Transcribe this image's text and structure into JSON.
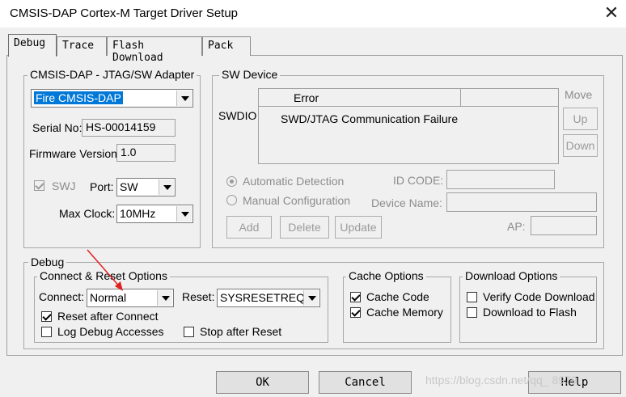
{
  "window": {
    "title": "CMSIS-DAP Cortex-M Target Driver Setup",
    "close_glyph": "✕"
  },
  "tabs": [
    {
      "label": "Debug",
      "active": true
    },
    {
      "label": "Trace",
      "active": false
    },
    {
      "label": "Flash Download",
      "active": false
    },
    {
      "label": "Pack",
      "active": false
    }
  ],
  "adapter": {
    "group_label": "CMSIS-DAP - JTAG/SW Adapter",
    "selected_adapter": "Fire CMSIS-DAP",
    "serial_label": "Serial No:",
    "serial_value": "HS-00014159",
    "firmware_label": "Firmware Version:",
    "firmware_value": "1.0",
    "swj_label": "SWJ",
    "swj_checked": true,
    "port_label": "Port:",
    "port_value": "SW",
    "max_clock_label": "Max Clock:",
    "max_clock_value": "10MHz"
  },
  "sw_device": {
    "group_label": "SW Device",
    "swdio_label": "SWDIO",
    "column_header": "Error",
    "error_text": "SWD/JTAG Communication Failure",
    "move_label": "Move",
    "up_label": "Up",
    "down_label": "Down",
    "auto_detect_label": "Automatic Detection",
    "manual_config_label": "Manual Configuration",
    "id_code_label": "ID CODE:",
    "device_name_label": "Device Name:",
    "ap_label": "AP:",
    "add_label": "Add",
    "delete_label": "Delete",
    "update_label": "Update"
  },
  "debug": {
    "group_label": "Debug",
    "connect_reset": {
      "group_label": "Connect & Reset Options",
      "connect_label": "Connect:",
      "connect_value": "Normal",
      "reset_label": "Reset:",
      "reset_value": "SYSRESETREQ",
      "reset_after_connect_label": "Reset after Connect",
      "reset_after_connect_checked": true,
      "log_debug_label": "Log Debug Accesses",
      "log_debug_checked": false,
      "stop_after_reset_label": "Stop after Reset",
      "stop_after_reset_checked": false
    },
    "cache": {
      "group_label": "Cache Options",
      "cache_code_label": "Cache Code",
      "cache_code_checked": true,
      "cache_memory_label": "Cache Memory",
      "cache_memory_checked": true
    },
    "download": {
      "group_label": "Download Options",
      "verify_label": "Verify Code Download",
      "verify_checked": false,
      "download_flash_label": "Download to Flash",
      "download_flash_checked": false
    }
  },
  "buttons": {
    "ok": "OK",
    "cancel": "Cancel",
    "help": "Help"
  },
  "watermark": "https://blog.csdn.net/qq_    8979",
  "colors": {
    "selection": "#0078d7",
    "annotation_arrow": "#e02020"
  }
}
